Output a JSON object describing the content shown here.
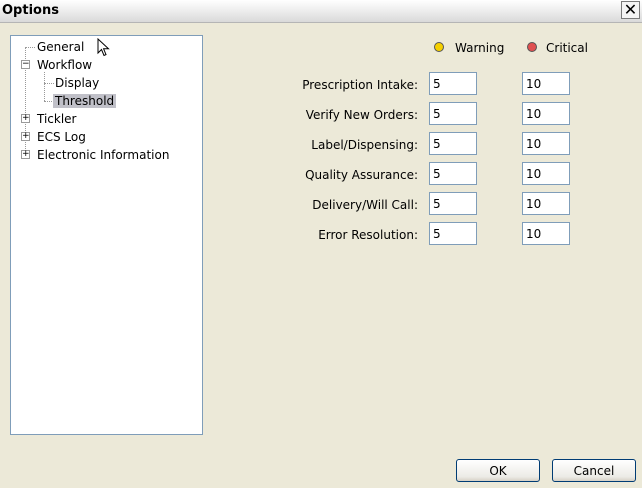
{
  "window": {
    "title": "Options",
    "close_glyph": "✕"
  },
  "tree": {
    "items": [
      {
        "label": "General"
      },
      {
        "label": "Workflow",
        "toggle": "−"
      },
      {
        "label": "Display"
      },
      {
        "label": "Threshold",
        "selected": true
      },
      {
        "label": "Tickler",
        "toggle": "+"
      },
      {
        "label": "ECS Log",
        "toggle": "+"
      },
      {
        "label": "Electronic Information",
        "toggle": "+"
      }
    ]
  },
  "legend": {
    "warning": {
      "label": "Warning",
      "color": "#f5d000"
    },
    "critical": {
      "label": "Critical",
      "color": "#e05050"
    }
  },
  "rows": [
    {
      "label": "Prescription Intake:",
      "warning": "5",
      "critical": "10"
    },
    {
      "label": "Verify New Orders:",
      "warning": "5",
      "critical": "10"
    },
    {
      "label": "Label/Dispensing:",
      "warning": "5",
      "critical": "10"
    },
    {
      "label": "Quality Assurance:",
      "warning": "5",
      "critical": "10"
    },
    {
      "label": "Delivery/Will Call:",
      "warning": "5",
      "critical": "10"
    },
    {
      "label": "Error Resolution:",
      "warning": "5",
      "critical": "10"
    }
  ],
  "buttons": {
    "ok": "OK",
    "cancel": "Cancel"
  }
}
